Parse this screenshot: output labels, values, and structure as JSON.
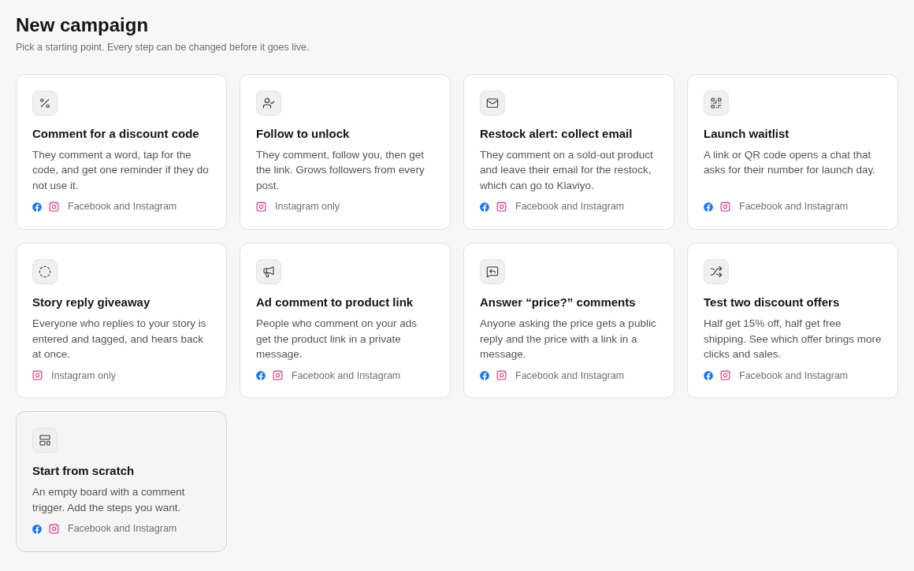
{
  "header": {
    "title": "New campaign",
    "subtitle": "Pick a starting point. Every step can be changed before it goes live."
  },
  "cards": [
    {
      "kind": "template",
      "title": "Comment for a discount code",
      "description": "They comment a word, tap for the code, and get one reminder if they do not use it.",
      "facebook": true,
      "instagram": true,
      "platforms": "Facebook and Instagram"
    },
    {
      "kind": "template",
      "title": "Follow to unlock",
      "description": "They comment, follow you, then get the link. Grows followers from every post.",
      "facebook": false,
      "instagram": true,
      "platforms": "Instagram only"
    },
    {
      "kind": "template",
      "title": "Restock alert: collect email",
      "description": "They comment on a sold-out product and leave their email for the restock, which can go to Klaviyo.",
      "facebook": true,
      "instagram": true,
      "platforms": "Facebook and Instagram"
    },
    {
      "kind": "template",
      "title": "Launch waitlist",
      "description": "A link or QR code opens a chat that asks for their number for launch day.",
      "facebook": true,
      "instagram": true,
      "platforms": "Facebook and Instagram"
    },
    {
      "kind": "template",
      "title": "Story reply giveaway",
      "description": "Everyone who replies to your story is entered and tagged, and hears back at once.",
      "facebook": false,
      "instagram": true,
      "platforms": "Instagram only"
    },
    {
      "kind": "template",
      "title": "Ad comment to product link",
      "description": "People who comment on your ads get the product link in a private message.",
      "facebook": true,
      "instagram": true,
      "platforms": "Facebook and Instagram"
    },
    {
      "kind": "template",
      "title": "Answer “price?” comments",
      "description": "Anyone asking the price gets a public reply and the price with a link in a message.",
      "facebook": true,
      "instagram": true,
      "platforms": "Facebook and Instagram"
    },
    {
      "kind": "template",
      "title": "Test two discount offers",
      "description": "Half get 15% off, half get free shipping. See which offer brings more clicks and sales.",
      "facebook": true,
      "instagram": true,
      "platforms": "Facebook and Instagram"
    },
    {
      "kind": "blank",
      "title": "Start from scratch",
      "description": "An empty board with a comment trigger. Add the steps you want.",
      "facebook": true,
      "instagram": true,
      "platforms": "Facebook and Instagram"
    }
  ]
}
